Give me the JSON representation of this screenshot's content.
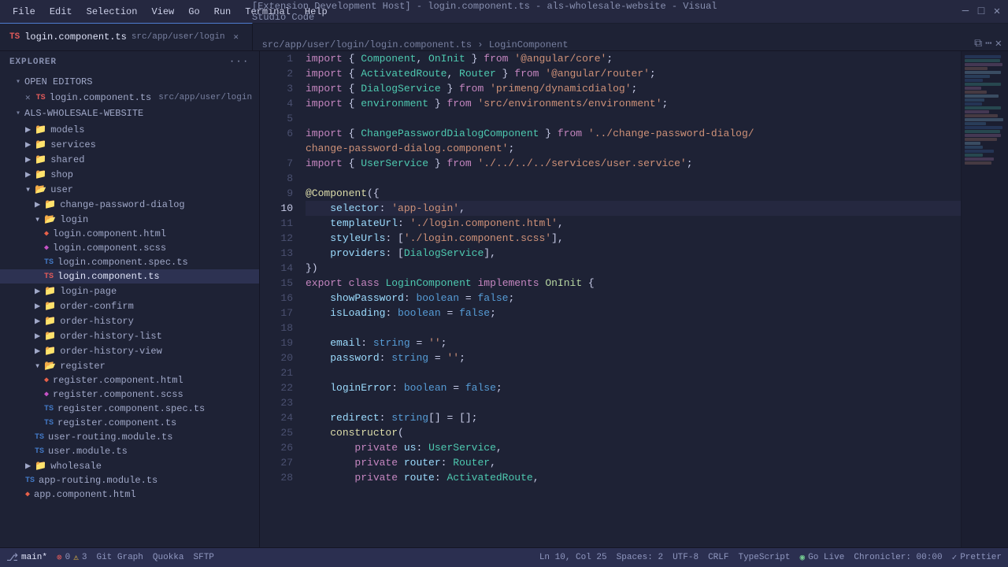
{
  "titlebar": {
    "menu": [
      "File",
      "Edit",
      "Selection",
      "View",
      "Go",
      "Run",
      "Terminal",
      "Help"
    ],
    "title": "[Extension Development Host] - login.component.ts - als-wholesale-website - Visual Studio Code",
    "win_minimize": "─",
    "win_maximize": "□",
    "win_close": "✕"
  },
  "tabs": [
    {
      "id": "login-component-ts",
      "label": "login.component.ts",
      "path": "src/app/user/login",
      "type": "ts-red",
      "active": true,
      "breadcrumb": "src/app/user/login/login.component.ts › LoginComponent"
    }
  ],
  "sidebar": {
    "header": "Explorer",
    "dots_label": "···",
    "sections": {
      "open_editors": "OPEN EDITORS",
      "project": "ALS-WHOLESALE-WEBSITE"
    },
    "open_editors": [
      {
        "name": "login.component.ts",
        "path": "src/app/user/login",
        "type": "ts-red",
        "closable": true
      }
    ],
    "tree": [
      {
        "label": "models",
        "type": "folder",
        "level": 1,
        "expanded": false
      },
      {
        "label": "services",
        "type": "folder",
        "level": 1,
        "expanded": false
      },
      {
        "label": "shared",
        "type": "folder",
        "level": 1,
        "expanded": false
      },
      {
        "label": "shop",
        "type": "folder",
        "level": 1,
        "expanded": false
      },
      {
        "label": "user",
        "type": "folder",
        "level": 1,
        "expanded": true
      },
      {
        "label": "change-password-dialog",
        "type": "folder",
        "level": 2,
        "expanded": false
      },
      {
        "label": "login",
        "type": "folder",
        "level": 2,
        "expanded": true
      },
      {
        "label": "login.component.html",
        "type": "html",
        "level": 3,
        "selected": false
      },
      {
        "label": "login.component.scss",
        "type": "scss",
        "level": 3,
        "selected": false
      },
      {
        "label": "login.component.spec.ts",
        "type": "ts",
        "level": 3,
        "selected": false
      },
      {
        "label": "login.component.ts",
        "type": "ts-red",
        "level": 3,
        "selected": true
      },
      {
        "label": "login-page",
        "type": "folder",
        "level": 2,
        "expanded": false
      },
      {
        "label": "order-confirm",
        "type": "folder",
        "level": 2,
        "expanded": false
      },
      {
        "label": "order-history",
        "type": "folder",
        "level": 2,
        "expanded": false
      },
      {
        "label": "order-history-list",
        "type": "folder",
        "level": 2,
        "expanded": false
      },
      {
        "label": "order-history-view",
        "type": "folder",
        "level": 2,
        "expanded": false
      },
      {
        "label": "register",
        "type": "folder",
        "level": 2,
        "expanded": true
      },
      {
        "label": "register.component.html",
        "type": "html",
        "level": 3,
        "selected": false
      },
      {
        "label": "register.component.scss",
        "type": "scss",
        "level": 3,
        "selected": false
      },
      {
        "label": "register.component.spec.ts",
        "type": "ts",
        "level": 3,
        "selected": false
      },
      {
        "label": "register.component.ts",
        "type": "ts",
        "level": 3,
        "selected": false
      },
      {
        "label": "user-routing.module.ts",
        "type": "ts",
        "level": 2,
        "selected": false
      },
      {
        "label": "user.module.ts",
        "type": "ts",
        "level": 2,
        "selected": false
      },
      {
        "label": "wholesale",
        "type": "folder",
        "level": 1,
        "expanded": false
      },
      {
        "label": "app-routing.module.ts",
        "type": "ts",
        "level": 1,
        "selected": false
      },
      {
        "label": "app.component.html",
        "type": "html",
        "level": 1,
        "selected": false
      }
    ]
  },
  "code": {
    "active_line": 10,
    "lines": [
      {
        "num": 1,
        "tokens": [
          {
            "t": "kw",
            "v": "import"
          },
          {
            "t": "plain",
            "v": " { "
          },
          {
            "t": "imp",
            "v": "Component"
          },
          {
            "t": "plain",
            "v": ", "
          },
          {
            "t": "imp",
            "v": "OnInit"
          },
          {
            "t": "plain",
            "v": " } "
          },
          {
            "t": "kw",
            "v": "from"
          },
          {
            "t": "plain",
            "v": " "
          },
          {
            "t": "str",
            "v": "'@angular/core'"
          },
          {
            "t": "plain",
            "v": ";"
          }
        ]
      },
      {
        "num": 2,
        "tokens": [
          {
            "t": "kw",
            "v": "import"
          },
          {
            "t": "plain",
            "v": " { "
          },
          {
            "t": "imp",
            "v": "ActivatedRoute"
          },
          {
            "t": "plain",
            "v": ", "
          },
          {
            "t": "imp",
            "v": "Router"
          },
          {
            "t": "plain",
            "v": " } "
          },
          {
            "t": "kw",
            "v": "from"
          },
          {
            "t": "plain",
            "v": " "
          },
          {
            "t": "str",
            "v": "'@angular/router'"
          },
          {
            "t": "plain",
            "v": ";"
          }
        ]
      },
      {
        "num": 3,
        "tokens": [
          {
            "t": "kw",
            "v": "import"
          },
          {
            "t": "plain",
            "v": " { "
          },
          {
            "t": "imp",
            "v": "DialogService"
          },
          {
            "t": "plain",
            "v": " } "
          },
          {
            "t": "kw",
            "v": "from"
          },
          {
            "t": "plain",
            "v": " "
          },
          {
            "t": "str",
            "v": "'primeng/dynamicdialog'"
          },
          {
            "t": "plain",
            "v": ";"
          }
        ]
      },
      {
        "num": 4,
        "tokens": [
          {
            "t": "kw",
            "v": "import"
          },
          {
            "t": "plain",
            "v": " { "
          },
          {
            "t": "imp",
            "v": "environment"
          },
          {
            "t": "plain",
            "v": " } "
          },
          {
            "t": "kw",
            "v": "from"
          },
          {
            "t": "plain",
            "v": " "
          },
          {
            "t": "str",
            "v": "'src/environments/environment'"
          },
          {
            "t": "plain",
            "v": ";"
          }
        ]
      },
      {
        "num": 5,
        "tokens": []
      },
      {
        "num": 6,
        "tokens": [
          {
            "t": "kw",
            "v": "import"
          },
          {
            "t": "plain",
            "v": " { "
          },
          {
            "t": "imp",
            "v": "ChangePasswordDialogComponent"
          },
          {
            "t": "plain",
            "v": " } "
          },
          {
            "t": "kw",
            "v": "from"
          },
          {
            "t": "plain",
            "v": " "
          },
          {
            "t": "str",
            "v": "'../change-password-dialog/"
          },
          {
            "t": "plain",
            "v": ""
          }
        ]
      },
      {
        "num": "",
        "tokens": [
          {
            "t": "str",
            "v": "change-password-dialog.component'"
          },
          {
            "t": "plain",
            "v": ";"
          }
        ]
      },
      {
        "num": 7,
        "tokens": [
          {
            "t": "kw",
            "v": "import"
          },
          {
            "t": "plain",
            "v": " { "
          },
          {
            "t": "imp",
            "v": "UserService"
          },
          {
            "t": "plain",
            "v": " } "
          },
          {
            "t": "kw",
            "v": "from"
          },
          {
            "t": "plain",
            "v": " "
          },
          {
            "t": "str",
            "v": "'./../../../services/user.service'"
          },
          {
            "t": "plain",
            "v": ";"
          }
        ]
      },
      {
        "num": 8,
        "tokens": []
      },
      {
        "num": 9,
        "tokens": [
          {
            "t": "at",
            "v": "@Component"
          },
          {
            "t": "plain",
            "v": "({"
          }
        ]
      },
      {
        "num": 10,
        "tokens": [
          {
            "t": "plain",
            "v": "    "
          },
          {
            "t": "prop",
            "v": "selector"
          },
          {
            "t": "plain",
            "v": ": "
          },
          {
            "t": "str",
            "v": "'app-login'"
          },
          {
            "t": "plain",
            "v": ","
          }
        ],
        "active": true
      },
      {
        "num": 11,
        "tokens": [
          {
            "t": "plain",
            "v": "    "
          },
          {
            "t": "prop",
            "v": "templateUrl"
          },
          {
            "t": "plain",
            "v": ": "
          },
          {
            "t": "str",
            "v": "'./login.component.html'"
          },
          {
            "t": "plain",
            "v": ","
          }
        ]
      },
      {
        "num": 12,
        "tokens": [
          {
            "t": "plain",
            "v": "    "
          },
          {
            "t": "prop",
            "v": "styleUrls"
          },
          {
            "t": "plain",
            "v": ": ["
          },
          {
            "t": "str",
            "v": "'./login.component.scss'"
          },
          {
            "t": "plain",
            "v": "],"
          }
        ]
      },
      {
        "num": 13,
        "tokens": [
          {
            "t": "plain",
            "v": "    "
          },
          {
            "t": "prop",
            "v": "providers"
          },
          {
            "t": "plain",
            "v": ": ["
          },
          {
            "t": "imp",
            "v": "DialogService"
          },
          {
            "t": "plain",
            "v": "],"
          }
        ]
      },
      {
        "num": 14,
        "tokens": [
          {
            "t": "plain",
            "v": "})"
          }
        ]
      },
      {
        "num": 15,
        "tokens": [
          {
            "t": "kw",
            "v": "export"
          },
          {
            "t": "plain",
            "v": " "
          },
          {
            "t": "kw",
            "v": "class"
          },
          {
            "t": "plain",
            "v": " "
          },
          {
            "t": "cls",
            "v": "LoginComponent"
          },
          {
            "t": "plain",
            "v": " "
          },
          {
            "t": "kw",
            "v": "implements"
          },
          {
            "t": "plain",
            "v": " "
          },
          {
            "t": "iface",
            "v": "OnInit"
          },
          {
            "t": "plain",
            "v": " {"
          }
        ]
      },
      {
        "num": 16,
        "tokens": [
          {
            "t": "plain",
            "v": "    "
          },
          {
            "t": "dec",
            "v": "showPassword"
          },
          {
            "t": "plain",
            "v": ": "
          },
          {
            "t": "kw2",
            "v": "boolean"
          },
          {
            "t": "plain",
            "v": " = "
          },
          {
            "t": "val",
            "v": "false"
          },
          {
            "t": "plain",
            "v": ";"
          }
        ]
      },
      {
        "num": 17,
        "tokens": [
          {
            "t": "plain",
            "v": "    "
          },
          {
            "t": "dec",
            "v": "isLoading"
          },
          {
            "t": "plain",
            "v": ": "
          },
          {
            "t": "kw2",
            "v": "boolean"
          },
          {
            "t": "plain",
            "v": " = "
          },
          {
            "t": "val",
            "v": "false"
          },
          {
            "t": "plain",
            "v": ";"
          }
        ]
      },
      {
        "num": 18,
        "tokens": []
      },
      {
        "num": 19,
        "tokens": [
          {
            "t": "plain",
            "v": "    "
          },
          {
            "t": "dec",
            "v": "email"
          },
          {
            "t": "plain",
            "v": ": "
          },
          {
            "t": "kw2",
            "v": "string"
          },
          {
            "t": "plain",
            "v": " = "
          },
          {
            "t": "str",
            "v": "''"
          },
          {
            "t": "plain",
            "v": ";"
          }
        ]
      },
      {
        "num": 20,
        "tokens": [
          {
            "t": "plain",
            "v": "    "
          },
          {
            "t": "dec",
            "v": "password"
          },
          {
            "t": "plain",
            "v": ": "
          },
          {
            "t": "kw2",
            "v": "string"
          },
          {
            "t": "plain",
            "v": " = "
          },
          {
            "t": "str",
            "v": "''"
          },
          {
            "t": "plain",
            "v": ";"
          }
        ]
      },
      {
        "num": 21,
        "tokens": []
      },
      {
        "num": 22,
        "tokens": [
          {
            "t": "plain",
            "v": "    "
          },
          {
            "t": "dec",
            "v": "loginError"
          },
          {
            "t": "plain",
            "v": ": "
          },
          {
            "t": "kw2",
            "v": "boolean"
          },
          {
            "t": "plain",
            "v": " = "
          },
          {
            "t": "val",
            "v": "false"
          },
          {
            "t": "plain",
            "v": ";"
          }
        ]
      },
      {
        "num": 23,
        "tokens": []
      },
      {
        "num": 24,
        "tokens": [
          {
            "t": "plain",
            "v": "    "
          },
          {
            "t": "dec",
            "v": "redirect"
          },
          {
            "t": "plain",
            "v": ": "
          },
          {
            "t": "kw2",
            "v": "string"
          },
          {
            "t": "plain",
            "v": "[] = [];"
          }
        ]
      },
      {
        "num": 25,
        "tokens": [
          {
            "t": "plain",
            "v": "    "
          },
          {
            "t": "fn",
            "v": "constructor"
          },
          {
            "t": "plain",
            "v": "("
          }
        ]
      },
      {
        "num": 26,
        "tokens": [
          {
            "t": "plain",
            "v": "        "
          },
          {
            "t": "kw",
            "v": "private"
          },
          {
            "t": "plain",
            "v": " "
          },
          {
            "t": "dec",
            "v": "us"
          },
          {
            "t": "plain",
            "v": ": "
          },
          {
            "t": "cls",
            "v": "UserService"
          },
          {
            "t": "plain",
            "v": ","
          }
        ]
      },
      {
        "num": 27,
        "tokens": [
          {
            "t": "plain",
            "v": "        "
          },
          {
            "t": "kw",
            "v": "private"
          },
          {
            "t": "plain",
            "v": " "
          },
          {
            "t": "dec",
            "v": "router"
          },
          {
            "t": "plain",
            "v": ": "
          },
          {
            "t": "cls",
            "v": "Router"
          },
          {
            "t": "plain",
            "v": ","
          }
        ]
      },
      {
        "num": 28,
        "tokens": [
          {
            "t": "plain",
            "v": "        "
          },
          {
            "t": "kw",
            "v": "private"
          },
          {
            "t": "plain",
            "v": " "
          },
          {
            "t": "dec",
            "v": "route"
          },
          {
            "t": "plain",
            "v": ": "
          },
          {
            "t": "cls",
            "v": "ActivatedRoute"
          },
          {
            "t": "plain",
            "v": ","
          }
        ]
      }
    ]
  },
  "statusbar": {
    "git_branch": "main*",
    "errors": "0",
    "warnings": "3",
    "git_label": "Git Graph",
    "quokka": "Quokka",
    "sftp": "SFTP",
    "position": "Ln 10, Col 25",
    "spaces": "Spaces: 2",
    "encoding": "UTF-8",
    "line_ending": "CRLF",
    "language": "TypeScript",
    "go_live": "Go Live",
    "chronicler": "Chronicler: 00:00",
    "prettier": "Prettier"
  }
}
